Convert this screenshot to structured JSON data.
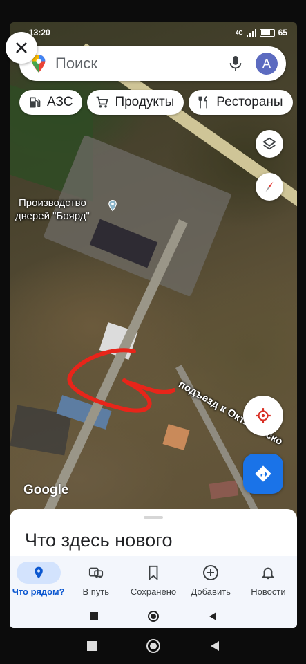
{
  "status_bar": {
    "time": "13:20",
    "signal_label": "4G",
    "battery": "65"
  },
  "search": {
    "placeholder": "Поиск",
    "avatar_letter": "A"
  },
  "chips": [
    {
      "label": "АЗС",
      "icon": "gas-station-icon"
    },
    {
      "label": "Продукты",
      "icon": "cart-icon"
    },
    {
      "label": "Рестораны",
      "icon": "restaurant-icon"
    }
  ],
  "map": {
    "place_name_line1": "Производство",
    "place_name_line2": "дверей \"Боярд\"",
    "street_label": "подъезд к Октябрьско",
    "attribution": "Google"
  },
  "sheet": {
    "title": "Что здесь нового"
  },
  "bottom_nav": [
    {
      "label": "Что рядом?",
      "icon": "location-pin-icon",
      "active": true
    },
    {
      "label": "В путь",
      "icon": "commute-icon",
      "active": false
    },
    {
      "label": "Сохранено",
      "icon": "bookmark-icon",
      "active": false
    },
    {
      "label": "Добавить",
      "icon": "add-circle-icon",
      "active": false
    },
    {
      "label": "Новости",
      "icon": "bell-icon",
      "active": false
    }
  ],
  "colors": {
    "accent": "#1a73e8",
    "active_pill": "#d3e3fd",
    "scribble": "#e8251a"
  }
}
